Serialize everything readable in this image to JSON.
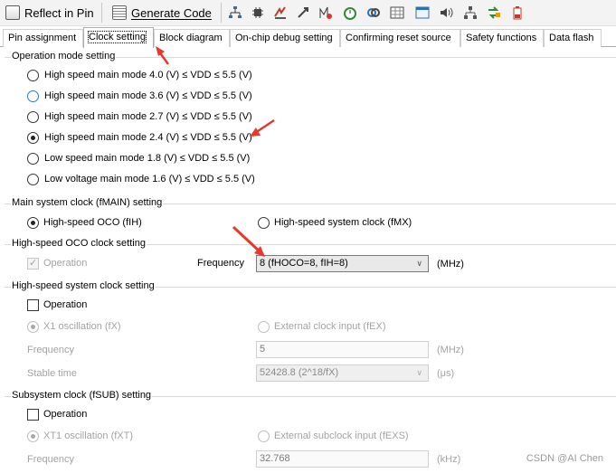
{
  "toolbar": {
    "reflect_label": "Reflect in Pin",
    "generate_label": "Generate Code"
  },
  "tabs": [
    {
      "label": "Pin assignment"
    },
    {
      "label": "Clock setting"
    },
    {
      "label": "Block diagram"
    },
    {
      "label": "On-chip debug setting"
    },
    {
      "label": "Confirming reset source"
    },
    {
      "label": "Safety functions"
    },
    {
      "label": "Data flash"
    }
  ],
  "operation_mode": {
    "title": "Operation mode setting",
    "options": [
      {
        "label": "High speed main mode 4.0 (V) ≤ VDD ≤ 5.5 (V)",
        "selected": false
      },
      {
        "label": "High speed main mode 3.6 (V) ≤ VDD ≤ 5.5 (V)",
        "selected": false
      },
      {
        "label": "High speed main mode 2.7 (V) ≤ VDD ≤ 5.5 (V)",
        "selected": false
      },
      {
        "label": "High speed main mode 2.4 (V) ≤ VDD ≤ 5.5 (V)",
        "selected": true
      },
      {
        "label": "Low speed main mode 1.8 (V) ≤ VDD ≤ 5.5 (V)",
        "selected": false
      },
      {
        "label": "Low voltage main mode 1.6 (V) ≤ VDD ≤ 5.5 (V)",
        "selected": false
      }
    ]
  },
  "main_clock": {
    "title": "Main system clock (fMAIN) setting",
    "oco_label": "High-speed OCO (fIH)",
    "fmx_label": "High-speed system clock (fMX)"
  },
  "oco": {
    "title": "High-speed OCO clock setting",
    "operation_label": "Operation",
    "frequency_label": "Frequency",
    "frequency_value": "8 (fHOCO=8, fIH=8)",
    "unit": "(MHz)"
  },
  "hs_system": {
    "title": "High-speed system clock setting",
    "operation_label": "Operation",
    "x1_label": "X1 oscillation (fX)",
    "ext_label": "External clock input (fEX)",
    "frequency_label": "Frequency",
    "frequency_value": "5",
    "frequency_unit": "(MHz)",
    "stable_label": "Stable time",
    "stable_value": "52428.8 (2^18/fX)",
    "stable_unit": "(μs)"
  },
  "subsystem": {
    "title": "Subsystem clock (fSUB) setting",
    "operation_label": "Operation",
    "xt1_label": "XT1 oscillation (fXT)",
    "ext_label": "External subclock input (fEXS)",
    "frequency_label": "Frequency",
    "frequency_value": "32.768",
    "frequency_unit": "(kHz)"
  },
  "watermark": "CSDN @AI Chen",
  "colors": {
    "annotation_arrow": "#e8382b",
    "accent_blue": "#2a7ac8"
  }
}
